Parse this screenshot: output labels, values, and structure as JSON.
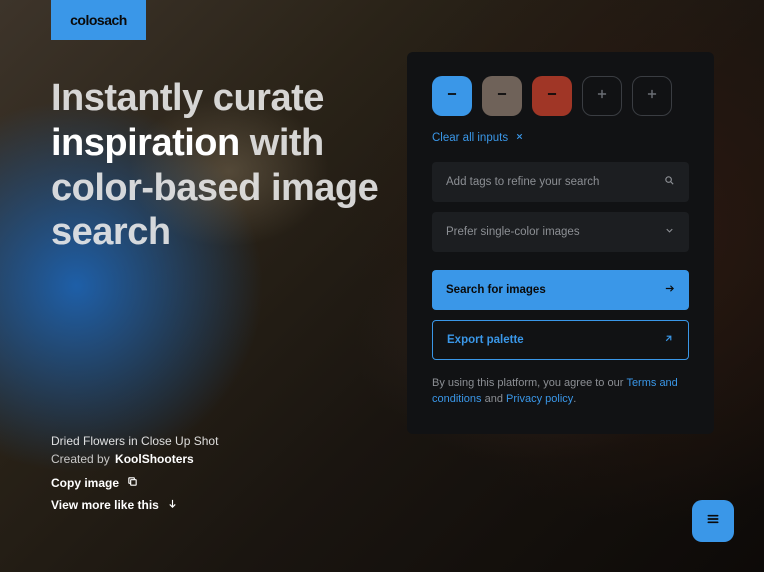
{
  "brand": {
    "name": "colosach"
  },
  "headline": {
    "pre": "Instantly curate ",
    "highlight": "inspiration",
    "post": " with color-based image search"
  },
  "caption": {
    "title": "Dried Flowers in Close Up Shot",
    "created_by_label": "Created by",
    "author": "KoolShooters",
    "copy_label": "Copy image",
    "more_label": "View more like this"
  },
  "panel": {
    "swatches": [
      {
        "color": "#3a97e8",
        "action": "remove"
      },
      {
        "color": "#6f6259",
        "action": "remove"
      },
      {
        "color": "#a03626",
        "action": "remove"
      },
      {
        "action": "add"
      },
      {
        "action": "add"
      }
    ],
    "clear_label": "Clear all inputs",
    "tags_placeholder": "Add tags to refine your search",
    "preference_label": "Prefer single-color images",
    "search_label": "Search for images",
    "export_label": "Export palette",
    "legal_pre": "By using this platform, you agree to our ",
    "legal_terms": "Terms and conditions",
    "legal_mid": " and ",
    "legal_privacy": "Privacy policy",
    "legal_post": "."
  },
  "colors": {
    "accent": "#3a97e8",
    "panel_bg": "#111214",
    "field_bg": "#1c1e21"
  }
}
